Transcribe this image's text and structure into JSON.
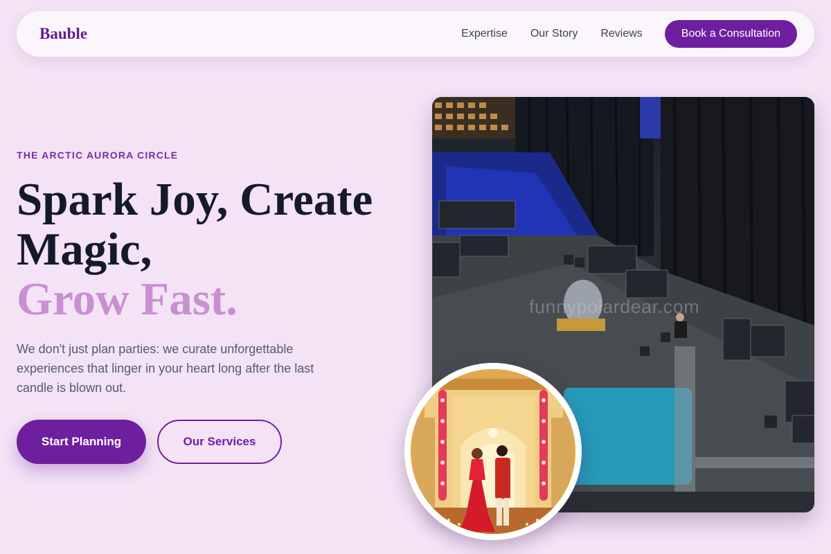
{
  "nav": {
    "logo": "Bauble",
    "links": [
      "Expertise",
      "Our Story",
      "Reviews"
    ],
    "cta": "Book a Consultation"
  },
  "hero": {
    "eyebrow": "THE ARCTIC AURORA CIRCLE",
    "headline_line1": "Spark Joy, Create",
    "headline_line2": "Magic,",
    "headline_accent": "Grow Fast.",
    "description": "We don't just plan parties: we curate unforgettable experiences that linger in your heart long after the last candle is blown out.",
    "primary_button": "Start Planning",
    "secondary_button": "Our Services",
    "watermark": "funnypolardear.com"
  },
  "colors": {
    "background": "#f3e3f5",
    "brand": "#6e1fa0",
    "accent_text": "#c98fd0"
  }
}
